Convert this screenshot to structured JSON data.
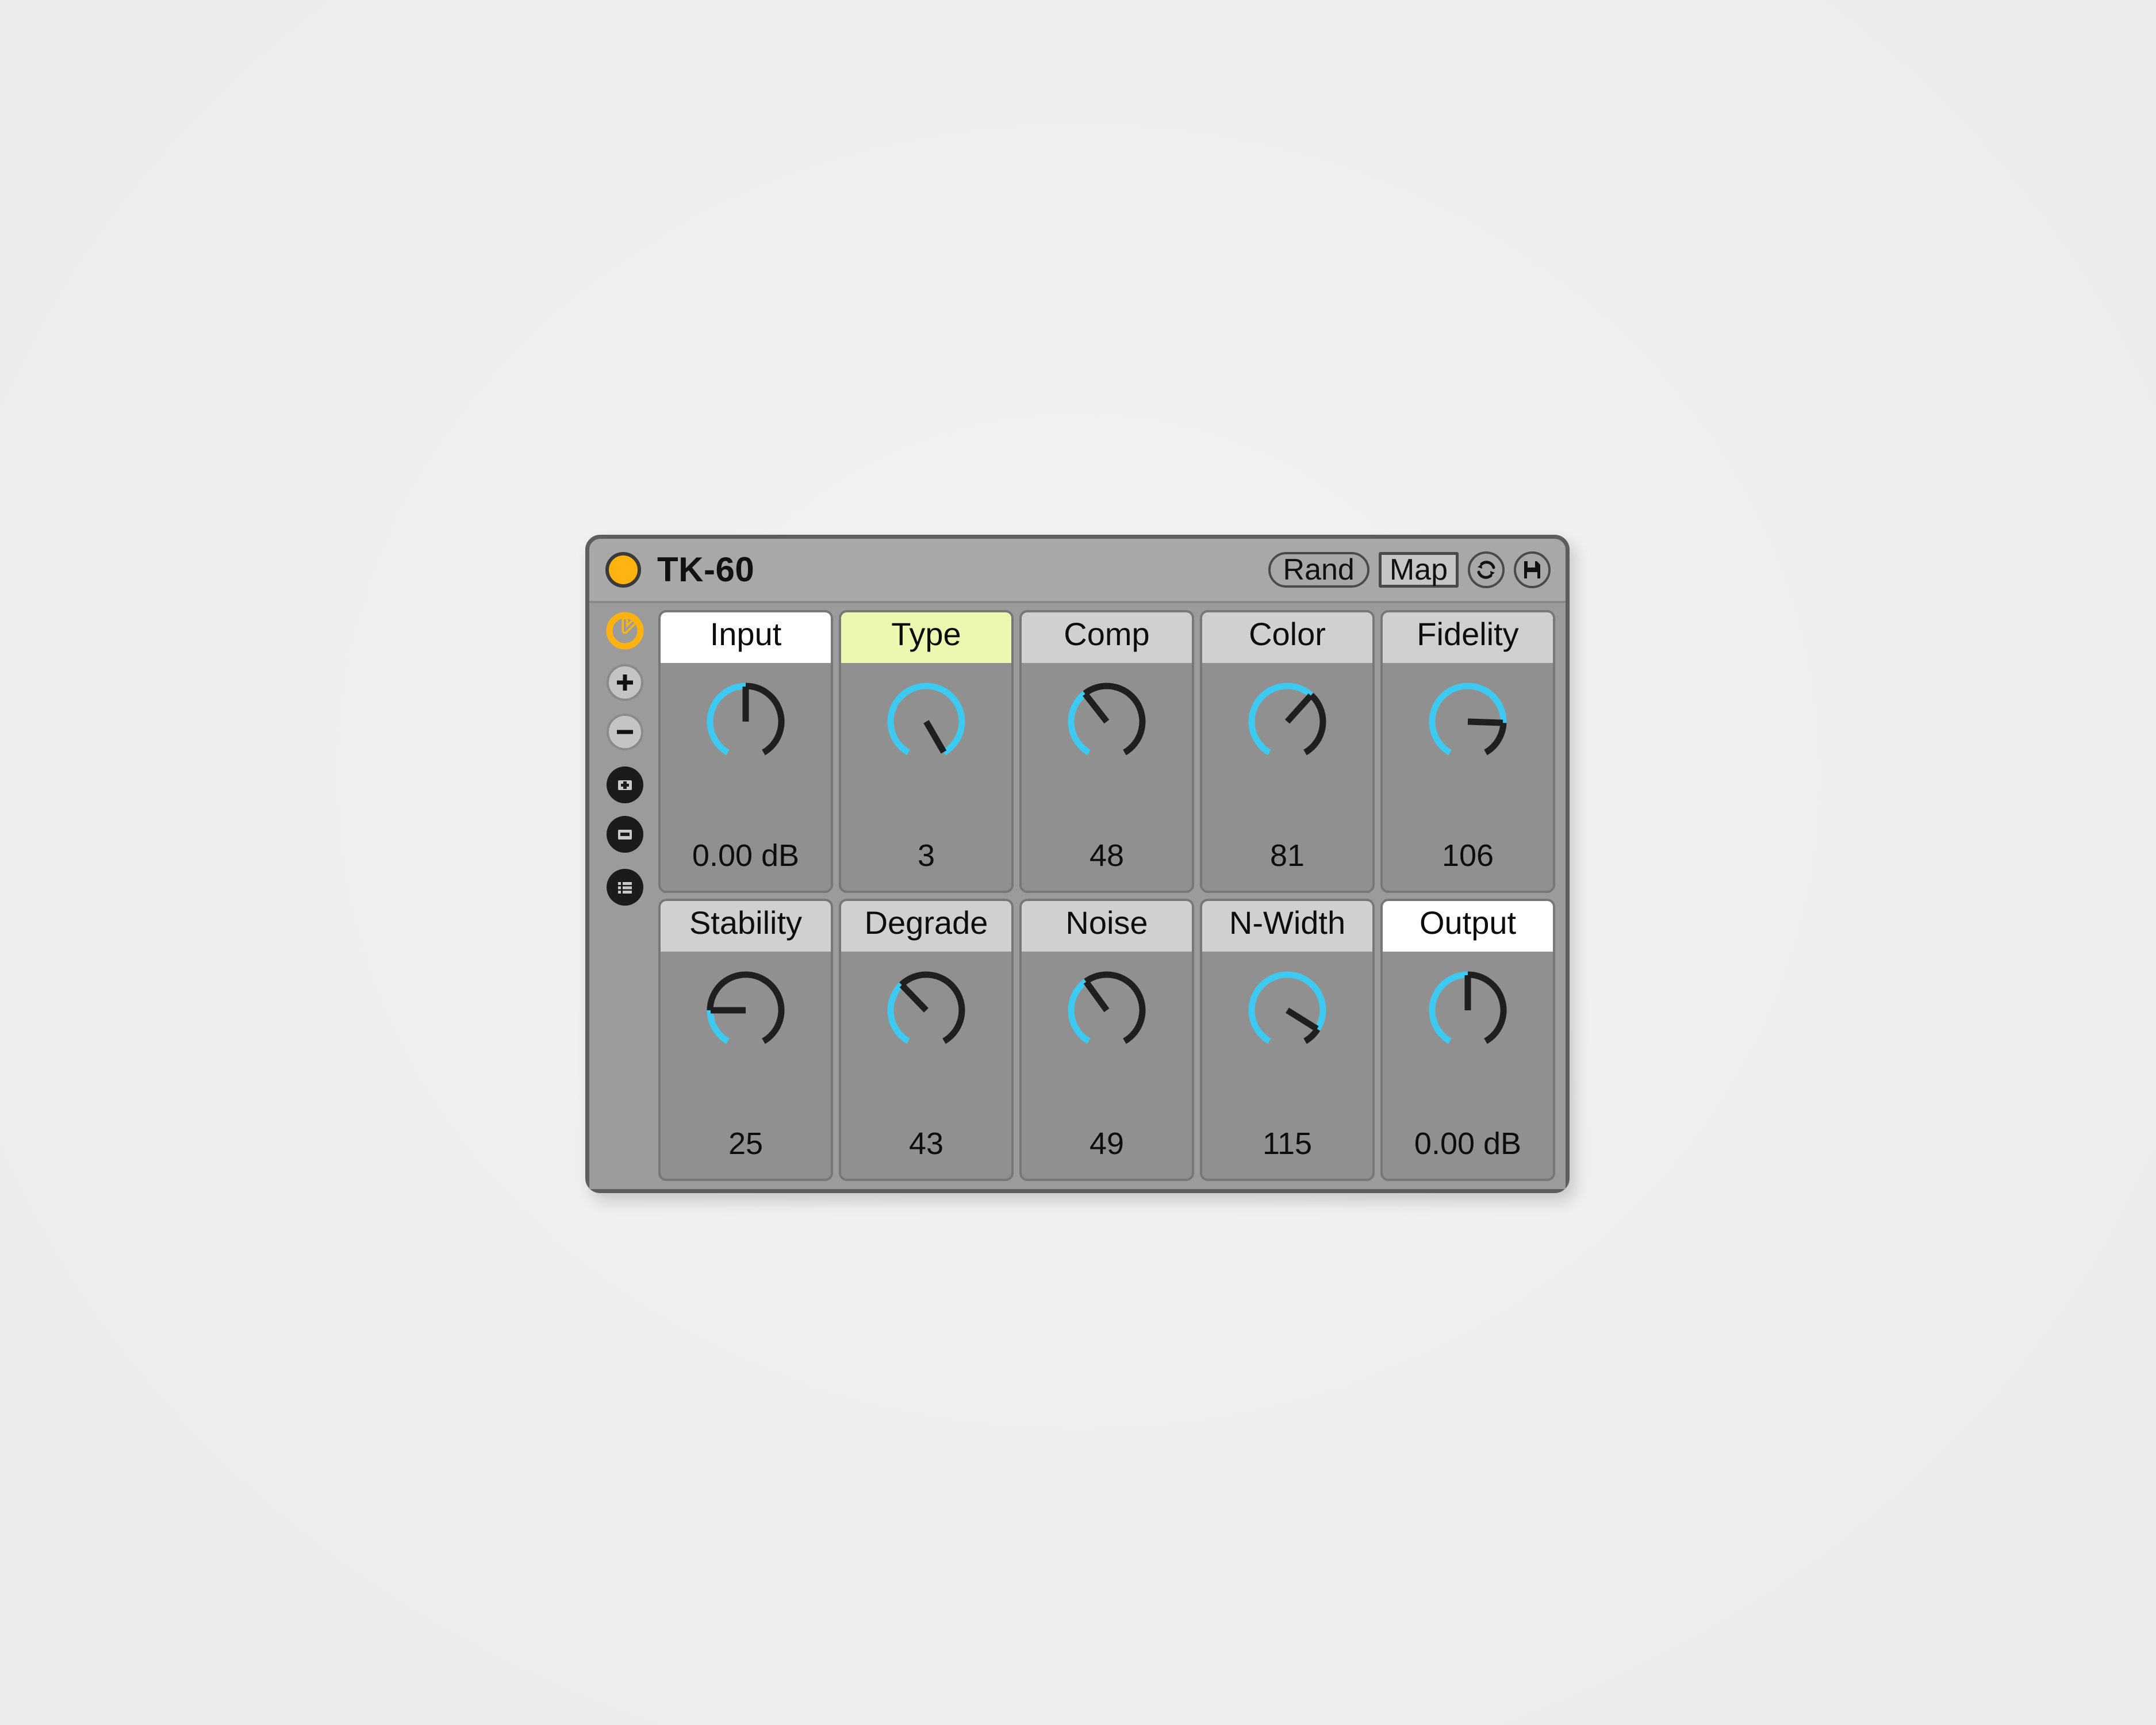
{
  "window": {
    "title": "TK-60",
    "power_on": true,
    "accent_color": "#ffb310",
    "arc_active_color": "#3dc9f0",
    "arc_track_color": "#1f1f1f",
    "body_color": "#9b9b9b",
    "titlebar_color": "#a8a8a8",
    "page_background": "#f0f0f0"
  },
  "header": {
    "rand_label": "Rand",
    "map_label": "Map",
    "icons": [
      {
        "name": "sync-icon"
      },
      {
        "name": "save-disk-icon"
      }
    ]
  },
  "sidebar": {
    "items": [
      {
        "name": "device-activator-icon",
        "style": "orange"
      },
      {
        "name": "add-icon",
        "style": "light"
      },
      {
        "name": "remove-icon",
        "style": "light"
      },
      {
        "name": "save-add-icon",
        "style": "dark"
      },
      {
        "name": "save-remove-icon",
        "style": "dark"
      },
      {
        "name": "list-icon",
        "style": "dark"
      }
    ]
  },
  "knobs": [
    {
      "label": "Input",
      "value": "0.00 dB",
      "label_style": "white",
      "arc_end_deg": 0,
      "pointer_deg": 0
    },
    {
      "label": "Type",
      "value": "3",
      "label_style": "yellow",
      "arc_end_deg": 150,
      "pointer_deg": 150
    },
    {
      "label": "Comp",
      "value": "48",
      "label_style": "grey",
      "arc_end_deg": -38,
      "pointer_deg": -38
    },
    {
      "label": "Color",
      "value": "81",
      "label_style": "grey",
      "arc_end_deg": 42,
      "pointer_deg": 42
    },
    {
      "label": "Fidelity",
      "value": "106",
      "label_style": "grey",
      "arc_end_deg": 92,
      "pointer_deg": 92
    },
    {
      "label": "Stability",
      "value": "25",
      "label_style": "grey",
      "arc_end_deg": -90,
      "pointer_deg": -90
    },
    {
      "label": "Degrade",
      "value": "43",
      "label_style": "grey",
      "arc_end_deg": -44,
      "pointer_deg": -44
    },
    {
      "label": "Noise",
      "value": "49",
      "label_style": "grey",
      "arc_end_deg": -36,
      "pointer_deg": -36
    },
    {
      "label": "N-Width",
      "value": "115",
      "label_style": "grey",
      "arc_end_deg": 122,
      "pointer_deg": 122
    },
    {
      "label": "Output",
      "value": "0.00 dB",
      "label_style": "white",
      "arc_end_deg": 0,
      "pointer_deg": 0
    }
  ]
}
